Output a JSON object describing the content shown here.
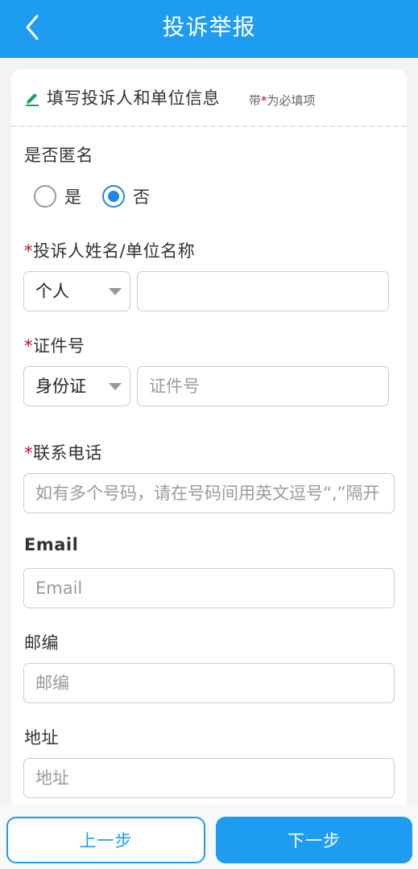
{
  "header": {
    "title": "投诉举报",
    "back_icon": "chevron-left-icon"
  },
  "section": {
    "icon": "edit-pen-icon",
    "title": "填写投诉人和单位信息",
    "note_prefix": "带",
    "note_star": "*",
    "note_suffix": "为必填项"
  },
  "anonymous": {
    "label": "是否匿名",
    "options": [
      {
        "label": "是",
        "checked": false
      },
      {
        "label": "否",
        "checked": true
      }
    ]
  },
  "complainant": {
    "required_mark": "*",
    "label": "投诉人姓名/单位名称",
    "type_value": "个人",
    "name_value": ""
  },
  "id_number": {
    "required_mark": "*",
    "label": "证件号",
    "type_value": "身份证",
    "placeholder": "证件号"
  },
  "phone": {
    "required_mark": "*",
    "label": "联系电话",
    "placeholder": "如有多个号码，请在号码间用英文逗号“,”隔开"
  },
  "email": {
    "label": "Email",
    "placeholder": "Email"
  },
  "postcode": {
    "label": "邮编",
    "placeholder": "邮编"
  },
  "address": {
    "label": "地址",
    "placeholder": "地址"
  },
  "footer": {
    "prev_label": "上一步",
    "next_label": "下一步"
  },
  "colors": {
    "brand": "#1e9cf1",
    "required": "#d0021b",
    "pen_icon": "#17a05d"
  }
}
